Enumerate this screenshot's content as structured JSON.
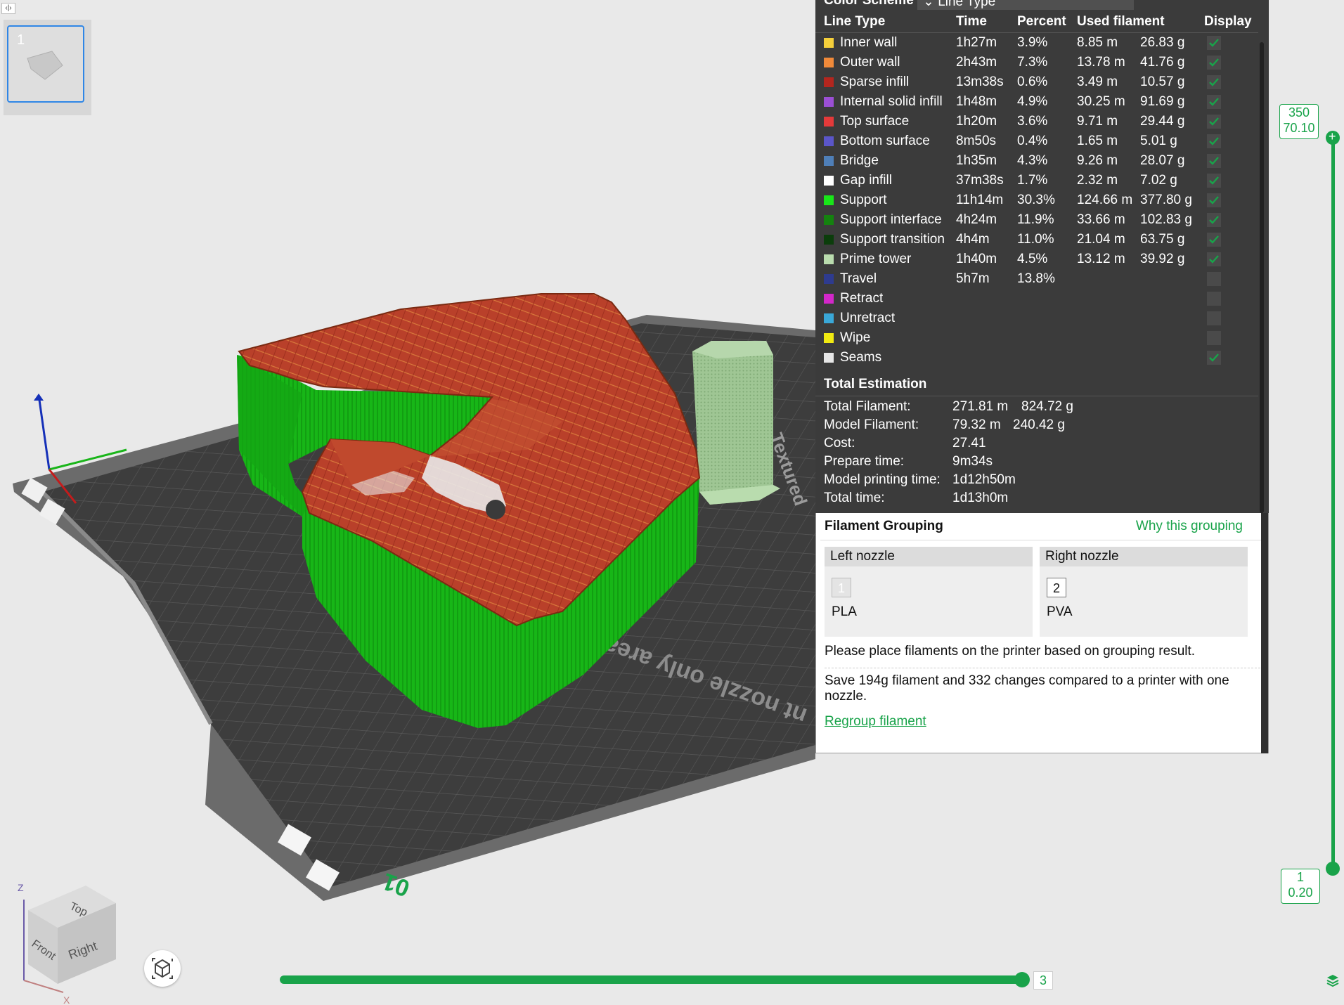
{
  "sidebar": {
    "collapse_label": "‹|›",
    "plate_number": "1"
  },
  "viewport": {
    "plate_text": "nt nozzle only area",
    "plate_text_2": "Textured",
    "plate_number_label": "01",
    "cube": {
      "top": "Top",
      "front": "Front",
      "right": "Right",
      "z": "Z",
      "x": "X"
    }
  },
  "legend": {
    "color_scheme_label": "Color Scheme",
    "color_scheme_value": "Line Type",
    "headers": {
      "line_type": "Line Type",
      "time": "Time",
      "percent": "Percent",
      "used_filament": "Used filament",
      "display": "Display"
    },
    "rows": [
      {
        "name": "Inner wall",
        "time": "1h27m",
        "percent": "3.9%",
        "length": "8.85 m",
        "weight": "26.83 g",
        "color": "#f5cf3b",
        "checked": true
      },
      {
        "name": "Outer wall",
        "time": "2h43m",
        "percent": "7.3%",
        "length": "13.78 m",
        "weight": "41.76 g",
        "color": "#f08a3a",
        "checked": true
      },
      {
        "name": "Sparse infill",
        "time": "13m38s",
        "percent": "0.6%",
        "length": "3.49 m",
        "weight": "10.57 g",
        "color": "#b3261e",
        "checked": true
      },
      {
        "name": "Internal solid infill",
        "time": "1h48m",
        "percent": "4.9%",
        "length": "30.25 m",
        "weight": "91.69 g",
        "color": "#9b4fd4",
        "checked": true
      },
      {
        "name": "Top surface",
        "time": "1h20m",
        "percent": "3.6%",
        "length": "9.71 m",
        "weight": "29.44 g",
        "color": "#e43a3a",
        "checked": true
      },
      {
        "name": "Bottom surface",
        "time": "8m50s",
        "percent": "0.4%",
        "length": "1.65 m",
        "weight": "5.01 g",
        "color": "#5b56c9",
        "checked": true
      },
      {
        "name": "Bridge",
        "time": "1h35m",
        "percent": "4.3%",
        "length": "9.26 m",
        "weight": "28.07 g",
        "color": "#4f7fb8",
        "checked": true
      },
      {
        "name": "Gap infill",
        "time": "37m38s",
        "percent": "1.7%",
        "length": "2.32 m",
        "weight": "7.02 g",
        "color": "#ffffff",
        "checked": true
      },
      {
        "name": "Support",
        "time": "11h14m",
        "percent": "30.3%",
        "length": "124.66 m",
        "weight": "377.80 g",
        "color": "#19e619",
        "checked": true
      },
      {
        "name": "Support interface",
        "time": "4h24m",
        "percent": "11.9%",
        "length": "33.66 m",
        "weight": "102.83 g",
        "color": "#14820f",
        "checked": true
      },
      {
        "name": "Support transition",
        "time": "4h4m",
        "percent": "11.0%",
        "length": "21.04 m",
        "weight": "63.75 g",
        "color": "#0b3d0b",
        "checked": true
      },
      {
        "name": "Prime tower",
        "time": "1h40m",
        "percent": "4.5%",
        "length": "13.12 m",
        "weight": "39.92 g",
        "color": "#b9dcae",
        "checked": true
      },
      {
        "name": "Travel",
        "time": "5h7m",
        "percent": "13.8%",
        "length": "",
        "weight": "",
        "color": "#2e3b8f",
        "checked": false
      },
      {
        "name": "Retract",
        "time": "",
        "percent": "",
        "length": "",
        "weight": "",
        "color": "#d327c9",
        "checked": false
      },
      {
        "name": "Unretract",
        "time": "",
        "percent": "",
        "length": "",
        "weight": "",
        "color": "#3aa8d8",
        "checked": false
      },
      {
        "name": "Wipe",
        "time": "",
        "percent": "",
        "length": "",
        "weight": "",
        "color": "#f1ea12",
        "checked": false
      },
      {
        "name": "Seams",
        "time": "",
        "percent": "",
        "length": "",
        "weight": "",
        "color": "#e6e6e6",
        "checked": true
      }
    ]
  },
  "totals": {
    "title": "Total Estimation",
    "rows": [
      {
        "label": "Total Filament:",
        "value": "271.81 m",
        "value2": "824.72 g"
      },
      {
        "label": "Model Filament:",
        "value": "79.32 m",
        "value2": "240.42 g"
      },
      {
        "label": "Cost:",
        "value": "27.41",
        "value2": ""
      },
      {
        "label": "Prepare time:",
        "value": "9m34s",
        "value2": ""
      },
      {
        "label": "Model printing time:",
        "value": "1d12h50m",
        "value2": ""
      },
      {
        "label": "Total time:",
        "value": "1d13h0m",
        "value2": ""
      }
    ]
  },
  "grouping": {
    "title": "Filament Grouping",
    "why_link": "Why this grouping",
    "left": {
      "header": "Left nozzle",
      "slot": "1",
      "material": "PLA"
    },
    "right": {
      "header": "Right nozzle",
      "slot": "2",
      "material": "PVA"
    },
    "note": "Please place filaments on the printer based on grouping result.",
    "save": "Save 194g filament and 332 changes compared to a printer with one nozzle.",
    "regroup": "Regroup filament"
  },
  "layer_slider": {
    "top_layer": "350",
    "top_height": "70.10",
    "bottom_layer": "1",
    "bottom_height": "0.20"
  },
  "move_slider": {
    "value": "3"
  },
  "colors": {
    "accent": "#19a34a",
    "panel": "#3b3b3b",
    "selection": "#2f86e6"
  }
}
